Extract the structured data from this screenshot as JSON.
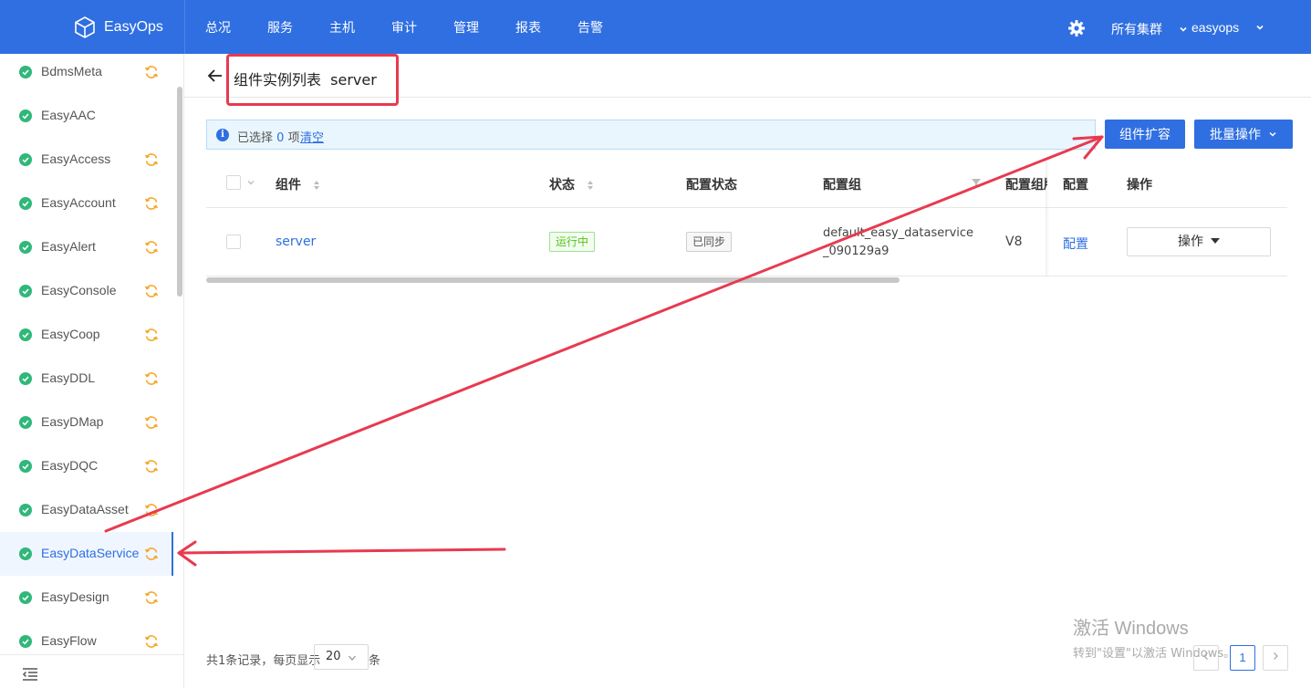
{
  "topbar": {
    "brand": "EasyOps",
    "nav": [
      "总况",
      "服务",
      "主机",
      "审计",
      "管理",
      "报表",
      "告警"
    ],
    "cluster": "所有集群",
    "user": "easyops",
    "settings_icon": "gear-icon"
  },
  "sidebar": {
    "items": [
      {
        "label": "BdmsMeta",
        "sync": true
      },
      {
        "label": "EasyAAC",
        "sync": false
      },
      {
        "label": "EasyAccess",
        "sync": true
      },
      {
        "label": "EasyAccount",
        "sync": true
      },
      {
        "label": "EasyAlert",
        "sync": true
      },
      {
        "label": "EasyConsole",
        "sync": true
      },
      {
        "label": "EasyCoop",
        "sync": true
      },
      {
        "label": "EasyDDL",
        "sync": true
      },
      {
        "label": "EasyDMap",
        "sync": true
      },
      {
        "label": "EasyDQC",
        "sync": true
      },
      {
        "label": "EasyDataAsset",
        "sync": true
      },
      {
        "label": "EasyDataService",
        "sync": true,
        "active": true
      },
      {
        "label": "EasyDesign",
        "sync": true
      },
      {
        "label": "EasyFlow",
        "sync": true
      }
    ]
  },
  "header": {
    "title": "组件实例列表  server"
  },
  "selection": {
    "prefix": "已选择",
    "count": "0",
    "suffix": "项",
    "clear": "清空"
  },
  "buttons": {
    "scale": "组件扩容",
    "batch": "批量操作"
  },
  "table": {
    "columns": {
      "component": "组件",
      "status": "状态",
      "config_status": "配置状态",
      "config_group": "配置组",
      "config_group_version": "配置组版",
      "config": "配置",
      "ops": "操作"
    },
    "rows": [
      {
        "component": "server",
        "status": "运行中",
        "config_status": "已同步",
        "config_group_line1": "default_easy_dataservice",
        "config_group_line2": "_090129a9",
        "version": "V8",
        "config": "配置",
        "ops": "操作"
      }
    ]
  },
  "pagination": {
    "summary": "共1条记录，每页显示",
    "page_size": "20",
    "unit": "条",
    "current_page": "1"
  },
  "watermark": {
    "line1": "激活 Windows",
    "line2": "转到\"设置\"以激活 Windows。"
  },
  "colors": {
    "primary": "#2f6fe1",
    "success": "#2fb879",
    "sync": "#f5a623",
    "annotation": "#e83a4f"
  }
}
